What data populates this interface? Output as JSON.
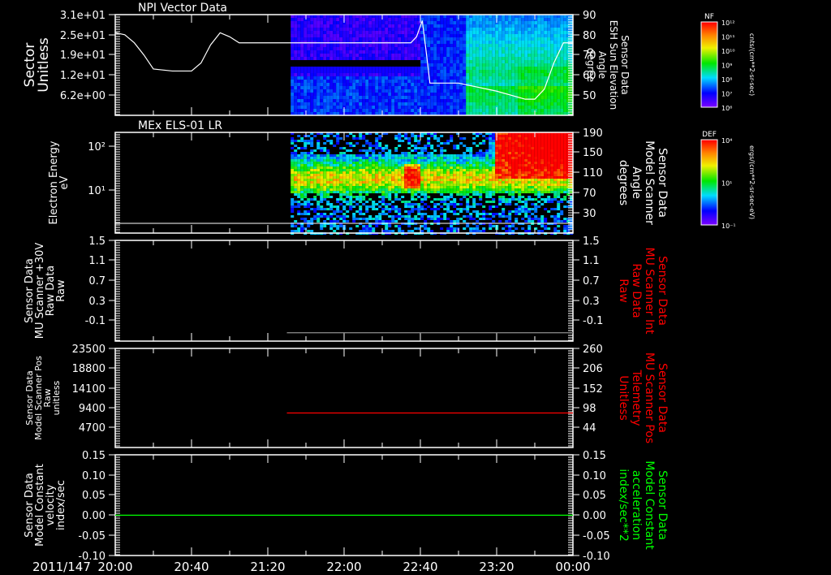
{
  "chart_data": [
    {
      "type": "heatmap",
      "title": "NPI Vector Data",
      "ylabel_left": [
        "Sector",
        "Unitless"
      ],
      "ylabel_right": [
        "Sensor Data",
        "ESH Sun Elevation",
        "Angle",
        "degree"
      ],
      "left_ticks": [
        "3.1e+01",
        "2.5e+01",
        "1.9e+01",
        "1.2e+01",
        "6.2e+00"
      ],
      "right_ticks": [
        "90",
        "80",
        "70",
        "60",
        "50"
      ],
      "ylim_right": [
        40,
        90
      ],
      "data_start": "21:32",
      "line_series": {
        "color": "#ffffff",
        "x": [
          "20:00",
          "20:05",
          "20:10",
          "20:15",
          "20:20",
          "20:30",
          "20:35",
          "20:40",
          "20:45",
          "20:50",
          "20:55",
          "21:00",
          "21:05",
          "22:35",
          "22:38",
          "22:41",
          "22:43",
          "22:45",
          "23:00",
          "23:20",
          "23:35",
          "23:40",
          "23:45",
          "23:50",
          "23:55",
          "00:00"
        ],
        "y": [
          81,
          80,
          76,
          70,
          63,
          62,
          62,
          62,
          66,
          75,
          81,
          79,
          76,
          76,
          79,
          87,
          72,
          56,
          56,
          52,
          48,
          48,
          53,
          66,
          76,
          76
        ]
      },
      "colorbar": {
        "label": "NF",
        "ticks": [
          "10¹²",
          "10¹¹",
          "10¹⁰",
          "10⁹",
          "10⁸",
          "10⁷",
          "10⁶"
        ],
        "units": "cnts/(cm**2-sr-sec)"
      }
    },
    {
      "type": "heatmap",
      "title": "MEx ELS-01 LR",
      "ylabel_left": [
        "Electron Energy",
        "eV"
      ],
      "ylabel_right": [
        "Sensor Data",
        "Model Scanner",
        "Angle",
        "degrees"
      ],
      "left_ticks": [
        "10²",
        "10¹"
      ],
      "right_ticks": [
        "190",
        "150",
        "110",
        "70",
        "30"
      ],
      "data_start": "21:32",
      "colorbar": {
        "label": "DEF",
        "ticks": [
          "10⁴",
          "10¹",
          "10⁻¹"
        ],
        "units": "ergs/(cm**2-sr-sec-eV)"
      }
    },
    {
      "type": "line",
      "ylabel_left": [
        "Sensor Data",
        "MU Scanner +30V",
        "Raw Data",
        "Raw"
      ],
      "ylabel_right": [
        "Sensor Data",
        "MU Scanner Int",
        "Raw Data",
        "Raw"
      ],
      "left_ticks": [
        "1.5",
        "1.1",
        "0.7",
        "0.3",
        "-0.1"
      ],
      "right_ticks": [
        "1.5",
        "1.1",
        "0.7",
        "0.3",
        "-0.1"
      ],
      "ylim": [
        -0.3,
        1.5
      ],
      "series": [
        {
          "color": "#808080",
          "x": [
            "21:30",
            "00:00"
          ],
          "y": [
            -0.15,
            -0.15
          ]
        }
      ],
      "right_label_color": "#ff0000"
    },
    {
      "type": "line",
      "ylabel_left": [
        "Sensor Data",
        "Model Scanner Pos",
        "Raw",
        "unitless"
      ],
      "ylabel_right": [
        "Sensor Data",
        "MU Scanner Pos",
        "Telemetry",
        "Unitless"
      ],
      "left_ticks": [
        "23500",
        "18800",
        "14100",
        "9400",
        "4700"
      ],
      "right_ticks": [
        "260",
        "206",
        "152",
        "98",
        "44"
      ],
      "ylim_right": [
        -10,
        260
      ],
      "series": [
        {
          "color": "#ff0000",
          "x": [
            "21:30",
            "00:00"
          ],
          "y": [
            84,
            84
          ]
        }
      ],
      "right_label_color": "#ff0000"
    },
    {
      "type": "line",
      "ylabel_left": [
        "Sensor Data",
        "Model Constant",
        "velocity",
        "index/sec"
      ],
      "ylabel_right": [
        "Sensor Data",
        "Model Constant",
        "acceleration",
        "index/sec**2"
      ],
      "left_ticks": [
        "0.15",
        "0.10",
        "0.05",
        "0.00",
        "-0.05",
        "-0.10"
      ],
      "right_ticks": [
        "0.15",
        "0.10",
        "0.05",
        "0.00",
        "-0.05",
        "-0.10"
      ],
      "ylim": [
        -0.1,
        0.15
      ],
      "series": [
        {
          "color": "#00ff00",
          "x": [
            "20:00",
            "00:00"
          ],
          "y": [
            0,
            0
          ]
        }
      ],
      "right_label_color": "#00ff00"
    }
  ],
  "x_axis": {
    "date": "2011/147",
    "ticks": [
      "20:00",
      "20:40",
      "21:20",
      "22:00",
      "22:40",
      "23:20",
      "00:00"
    ]
  }
}
